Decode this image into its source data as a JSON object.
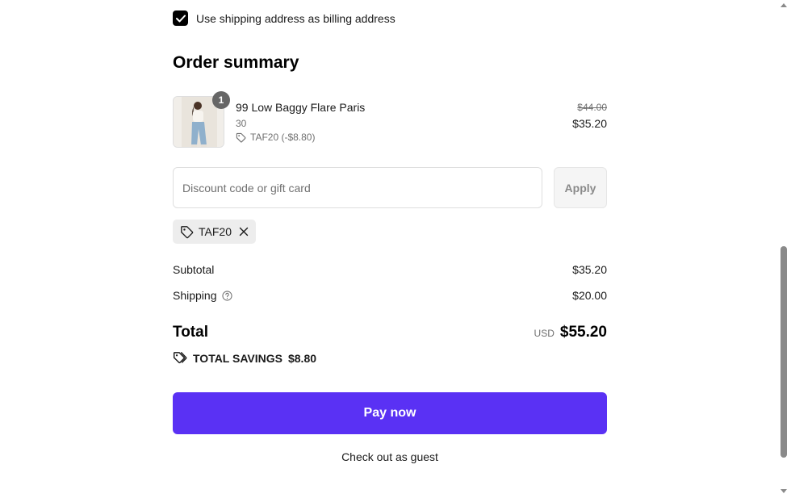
{
  "billing": {
    "label": "Use shipping address as billing address",
    "checked": true
  },
  "order_summary": {
    "title": "Order summary",
    "product": {
      "name": "99 Low Baggy Flare Paris",
      "variant": "30",
      "discount_line": "TAF20 (-$8.80)",
      "original_price": "$44.00",
      "price": "$35.20",
      "quantity": "1"
    },
    "discount": {
      "placeholder": "Discount code or gift card",
      "apply_label": "Apply",
      "applied_code": "TAF20"
    },
    "subtotal": {
      "label": "Subtotal",
      "value": "$35.20"
    },
    "shipping": {
      "label": "Shipping",
      "value": "$20.00"
    },
    "total": {
      "label": "Total",
      "currency": "USD",
      "value": "$55.20"
    },
    "savings": {
      "label": "TOTAL SAVINGS",
      "value": "$8.80"
    }
  },
  "actions": {
    "pay_label": "Pay now",
    "guest_label": "Check out as guest"
  },
  "colors": {
    "accent": "#5a31f4",
    "badge": "#666666",
    "muted": "#707070"
  }
}
